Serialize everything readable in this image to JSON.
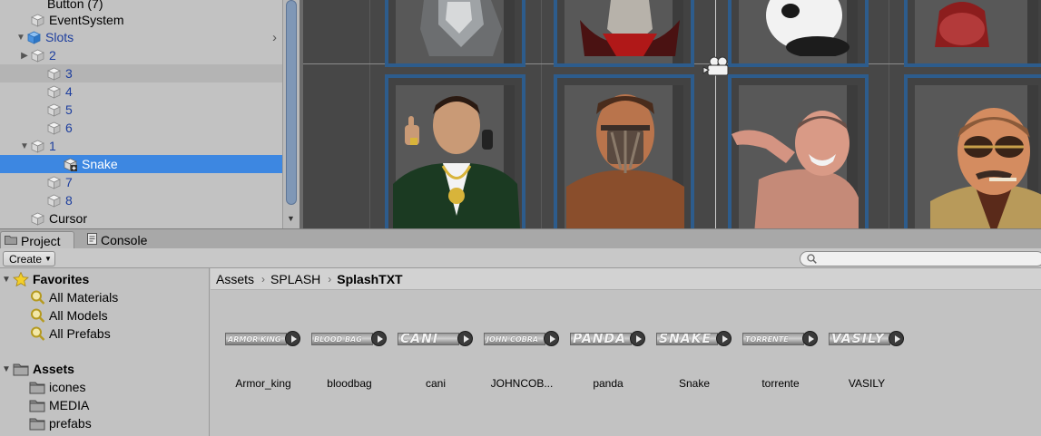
{
  "hierarchy": {
    "items": [
      {
        "label": "Button (7)",
        "color": "normal"
      },
      {
        "label": "EventSystem",
        "color": "normal"
      },
      {
        "label": "Slots",
        "color": "blue"
      },
      {
        "label": "2",
        "color": "blue"
      },
      {
        "label": "3",
        "color": "blue"
      },
      {
        "label": "4",
        "color": "blue"
      },
      {
        "label": "5",
        "color": "blue"
      },
      {
        "label": "6",
        "color": "blue"
      },
      {
        "label": "1",
        "color": "blue"
      },
      {
        "label": "Snake",
        "color": "selected"
      },
      {
        "label": "7",
        "color": "blue"
      },
      {
        "label": "8",
        "color": "blue"
      },
      {
        "label": "Cursor",
        "color": "normal"
      }
    ]
  },
  "scene": {
    "slot_border_color": "#2d5c8c",
    "icons": [
      "camera-icon"
    ]
  },
  "tabs": {
    "project": "Project",
    "console": "Console"
  },
  "toolbar": {
    "create_label": "Create",
    "search_placeholder": ""
  },
  "project_tree": {
    "favorites_label": "Favorites",
    "favorites": [
      "All Materials",
      "All Models",
      "All Prefabs"
    ],
    "assets_label": "Assets",
    "folders": [
      "icones",
      "MEDIA",
      "prefabs"
    ]
  },
  "breadcrumb": {
    "items": [
      "Assets",
      "SPLASH",
      "SplashTXT"
    ]
  },
  "assets": [
    {
      "name": "Armor_king",
      "thumb_text": "ARMOR KING"
    },
    {
      "name": "bloodbag",
      "thumb_text": "BLOOD BAG"
    },
    {
      "name": "cani",
      "thumb_text": "CANI"
    },
    {
      "name": "JOHNCOB...",
      "thumb_text": "JOHN COBRA"
    },
    {
      "name": "panda",
      "thumb_text": "PANDA"
    },
    {
      "name": "Snake",
      "thumb_text": "SNAKE"
    },
    {
      "name": "torrente",
      "thumb_text": "TORRENTE"
    },
    {
      "name": "VASILY",
      "thumb_text": "VASILY"
    }
  ]
}
